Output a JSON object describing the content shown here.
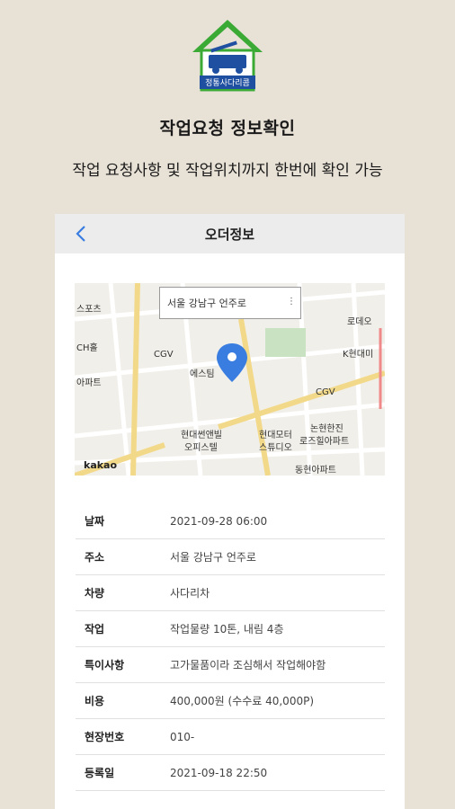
{
  "logo": {
    "text": "정통사다리콤"
  },
  "headline": "작업요청 정보확인",
  "subline": "작업 요청사항 및 작업위치까지 한번에 확인 가능",
  "card": {
    "title": "오더정보",
    "map": {
      "address": "서울 강남구 언주로",
      "labels": [
        "스포츠",
        "CH홀",
        "CGV",
        "에스팀",
        "아파트",
        "현대썬앤빌",
        "오피스텔",
        "현대모터",
        "스튜디오",
        "논현한진",
        "로즈힐아파트",
        "CGV",
        "K현대미",
        "동현아파트",
        "로데오",
        "kakao"
      ]
    },
    "rows": [
      {
        "label": "날짜",
        "value": "2021-09-28 06:00"
      },
      {
        "label": "주소",
        "value": "서울 강남구 언주로"
      },
      {
        "label": "차량",
        "value": "사다리차"
      },
      {
        "label": "작업",
        "value": "작업물량 10톤, 내림 4층"
      },
      {
        "label": "특이사항",
        "value": "고가물품이라 조심해서 작업해야함"
      },
      {
        "label": "비용",
        "value": "400,000원 (수수료 40,000P)"
      },
      {
        "label": "현장번호",
        "value": "010-"
      },
      {
        "label": "등록일",
        "value": "2021-09-18 22:50"
      }
    ]
  },
  "colors": {
    "accent": "#3a7de0",
    "logo_green": "#3aaa35",
    "logo_blue": "#1f4fa0",
    "background": "#e8e1d6"
  }
}
